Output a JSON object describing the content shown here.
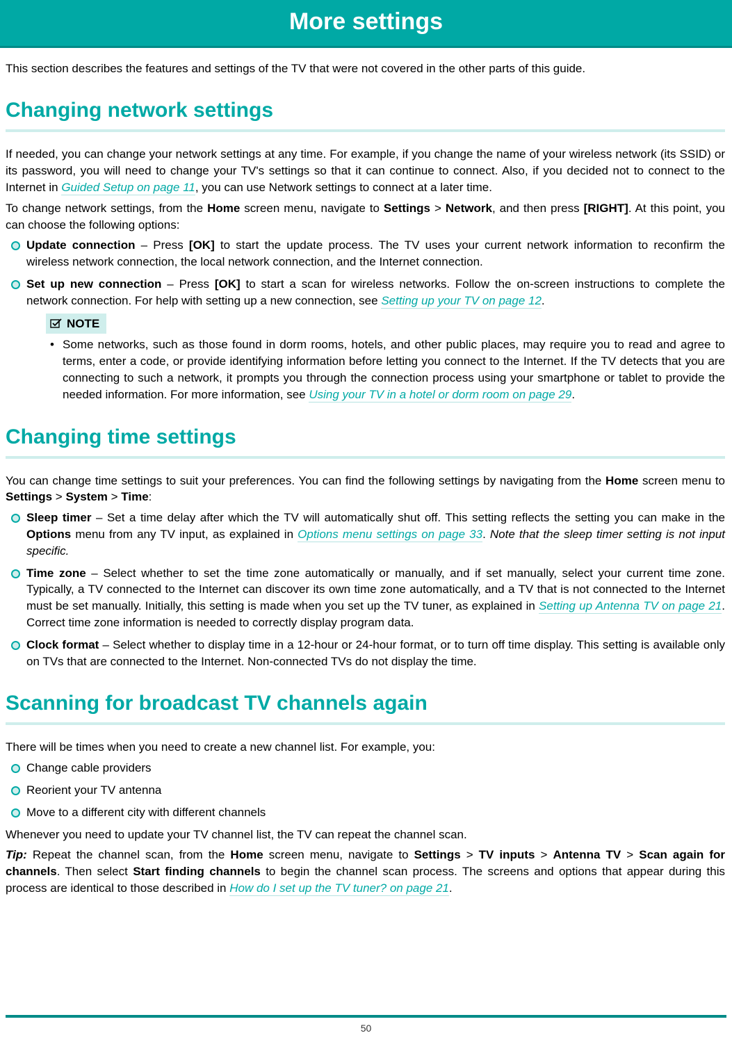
{
  "title": "More settings",
  "intro": "This section describes the features and settings of the TV that were not covered in the other parts of this guide.",
  "s1": {
    "heading": "Changing network settings",
    "p1a": "If needed, you can change your network settings at any time. For example, if you change the name of your wireless network (its SSID) or its password, you will need to change your TV's settings so that it can continue to connect. Also, if you decided not to connect to the Internet in ",
    "p1link": "Guided Setup on page 11",
    "p1b": ", you can use Network settings to connect at a later time.",
    "p2a": "To change network settings, from the ",
    "p2home": "Home",
    "p2b": " screen menu, navigate to ",
    "p2settings": "Settings",
    "gt": " > ",
    "p2network": "Network",
    "p2c": ", and then press ",
    "p2right": "[RIGHT]",
    "p2d": ". At this point, you can choose the following options:",
    "b1a": "Update connection",
    "b1b": " – Press ",
    "b1ok": "[OK]",
    "b1c": " to start the update process. The TV uses your current network information to reconfirm the wireless network connection, the local network connection, and the Internet connection.",
    "b2a": "Set up new connection",
    "b2b": " – Press ",
    "b2ok": "[OK]",
    "b2c": " to start a scan for wireless networks. Follow the on-screen instructions to complete the network connection. For help with setting up a new connection, see ",
    "b2link": "Setting up your TV on page 12",
    "b2d": ".",
    "notelabel": "NOTE",
    "note1a": "Some networks, such as those found in dorm rooms, hotels, and other public places, may require you to read and agree to terms, enter a code, or provide identifying information before letting you connect to the Internet. If the TV detects that you are connecting to such a network, it prompts you through the connection process using your smartphone or tablet to provide the needed information. For more information, see ",
    "note1link": "Using your TV in a hotel or dorm room on page 29",
    "note1b": "."
  },
  "s2": {
    "heading": "Changing time settings",
    "p1a": "You can change time settings to suit your preferences. You can find the following settings by navigating from the ",
    "home": "Home",
    "p1b": " screen menu to ",
    "settings": "Settings",
    "gt": " > ",
    "system": "System",
    "time": "Time",
    "p1c": ":",
    "b1a": "Sleep timer",
    "b1b": " – Set a time delay after which the TV will automatically shut off. This setting reflects the setting you can make in the ",
    "b1opt": "Options",
    "b1c": " menu from any TV input, as explained in ",
    "b1link": "Options menu settings on page 33",
    "b1d": ". ",
    "b1ital": "Note that the sleep timer setting is not input specific.",
    "b2a": "Time zone",
    "b2b": " – Select whether to set the time zone automatically or manually, and if set manually, select your current time zone. Typically, a TV connected to the Internet can discover its own time zone automatically, and a TV that is not connected to the Internet must be set manually. Initially, this setting is made when you set up the TV tuner, as explained in ",
    "b2link": "Setting up Antenna TV on page 21",
    "b2c": ". Correct time zone information is needed to correctly display program data.",
    "b3a": "Clock format",
    "b3b": " – Select whether to display time in a 12-hour or 24-hour format, or to turn off time display. This setting is available only on TVs that are connected to the Internet. Non-connected TVs do not display the time."
  },
  "s3": {
    "heading": "Scanning for broadcast TV channels again",
    "p1": "There will be times when you need to create a new channel list. For example, you:",
    "b1": "Change cable providers",
    "b2": "Reorient your TV antenna",
    "b3": "Move to a different city with different channels",
    "p2": "Whenever you need to update your TV channel list, the TV can repeat the channel scan.",
    "tip_prefix": "Tip:",
    "tip_a": " Repeat the channel scan, from the ",
    "home": "Home",
    "tip_b": " screen menu, navigate to ",
    "settings": "Settings",
    "gt": " > ",
    "tvinputs": "TV inputs",
    "antenna": "Antenna TV",
    "scan": "Scan again for channels",
    "tip_c": ". Then select ",
    "start": "Start finding channels",
    "tip_d": " to begin the channel scan process. The screens and options that appear during this process are identical to those described in ",
    "tiplink": "How do I set up the TV tuner? on page 21",
    "tip_e": "."
  },
  "page_number": "50"
}
